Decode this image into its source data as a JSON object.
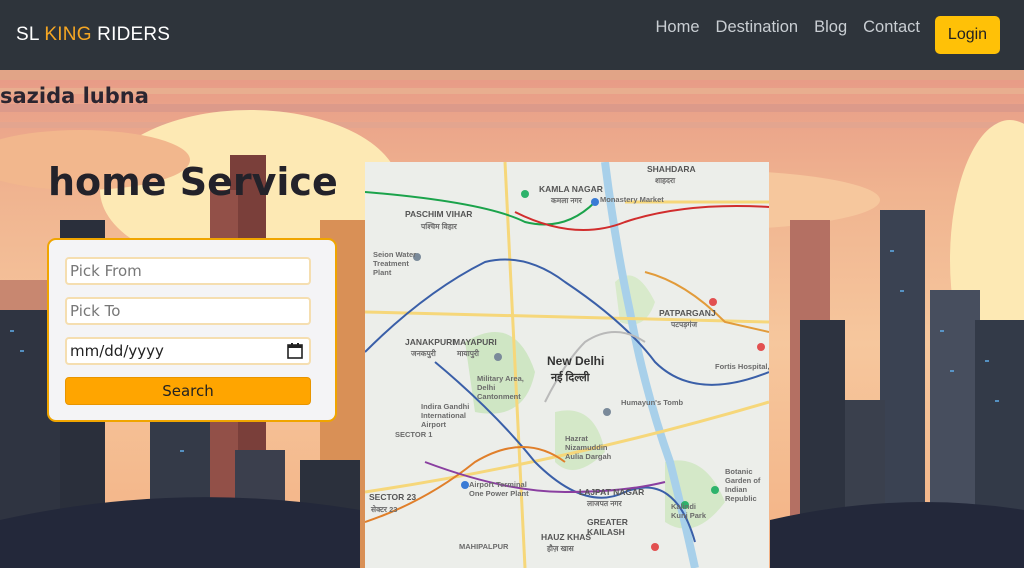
{
  "navbar": {
    "brand": {
      "part1": "SL ",
      "part2": "KING",
      "part3": " RIDERS"
    },
    "links": [
      "Home",
      "Destination",
      "Blog",
      "Contact"
    ],
    "login_label": "Login"
  },
  "user": {
    "name": "sazida lubna"
  },
  "hero": {
    "title": "home Service"
  },
  "form": {
    "pick_from_placeholder": "Pick From",
    "pick_to_placeholder": "Pick To",
    "date_value": "mm/dd/yyyy",
    "search_label": "Search"
  },
  "map": {
    "labels": {
      "shahdara": "SHAHDARA",
      "shahdara_hi": "शाहदरा",
      "kamla_nagar": "KAMLA NAGAR",
      "kamla_nagar_hi": "कमला नगर",
      "monastery": "Monastery Market",
      "paschim_vihar": "PASCHIM VIHAR",
      "paschim_vihar_hi": "पश्चिम विहार",
      "seion_water": "Seion Water Treatment Plant",
      "patparganj": "PATPARGANJ",
      "patparganj_hi": "पटपड़गंज",
      "janakpuri": "JANAKPURI",
      "janakpuri_hi": "जनकपुरी",
      "mayapuri": "MAYAPURI",
      "mayapuri_hi": "मायापुरी",
      "new_delhi": "New Delhi",
      "new_delhi_hi": "नई दिल्ली",
      "military_area": "Military Area, Delhi Cantonment",
      "fortis": "Fortis Hospital, Noida",
      "humayun": "Humayun's Tomb",
      "igi_airport": "Indira Gandhi International Airport",
      "hazrat": "Hazrat Nizamuddin Aulia Dargah",
      "airport_terminal": "Airport Terminal One Power Plant",
      "lajpat_nagar": "LAJPAT NAGAR",
      "lajpat_nagar_hi": "लाजपत नगर",
      "sector_23": "SECTOR 23",
      "sector_23_hi": "सेक्टर 23",
      "hauz_khas": "HAUZ KHAS",
      "hauz_khas_hi": "हौज़ खास",
      "greater_kailash": "GREATER KAILASH",
      "kalindi": "Kalindi Kunj Park",
      "botanic": "Botanic Garden of Indian Republic",
      "mahipalpur": "MAHIPALPUR",
      "sector_1": "SECTOR 1"
    }
  },
  "colors": {
    "navbar_bg": "#2e343b",
    "brand_accent": "#f5a623",
    "login_bg": "#ffc107",
    "search_bg": "#ffa500",
    "card_border": "#f0a500"
  }
}
